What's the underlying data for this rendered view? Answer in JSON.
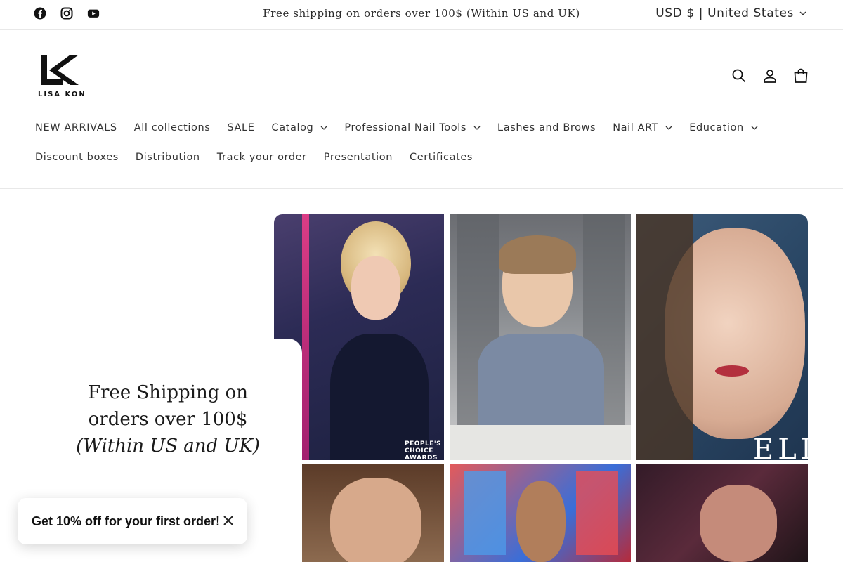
{
  "announcement": {
    "text": "Free shipping on orders over 100$ (Within US and UK)",
    "social_icons": [
      "facebook-icon",
      "instagram-icon",
      "youtube-icon"
    ],
    "currency_label": "USD $ | United States"
  },
  "brand": {
    "logo_text": "LISA KON"
  },
  "header": {
    "icons": [
      "search-icon",
      "account-icon",
      "cart-icon"
    ]
  },
  "nav": {
    "row1": [
      {
        "label": "NEW ARRIVALS",
        "dropdown": false
      },
      {
        "label": "All collections",
        "dropdown": false
      },
      {
        "label": "SALE",
        "dropdown": false
      },
      {
        "label": "Catalog",
        "dropdown": true
      },
      {
        "label": "Professional Nail Tools",
        "dropdown": true
      },
      {
        "label": "Lashes and Brows",
        "dropdown": false
      },
      {
        "label": "Nail ART",
        "dropdown": true
      },
      {
        "label": "Education",
        "dropdown": true
      }
    ],
    "row2": [
      {
        "label": "Discount boxes",
        "dropdown": false
      },
      {
        "label": "Distribution",
        "dropdown": false
      },
      {
        "label": "Track your order",
        "dropdown": false
      },
      {
        "label": "Presentation",
        "dropdown": false
      },
      {
        "label": "Certificates",
        "dropdown": false
      }
    ]
  },
  "hero": {
    "title_line": "Free Shipping on orders over 100$",
    "title_italic": "(Within US and UK)",
    "captions": {
      "peoples_choice": "PEOPLE'S\nCHOICE\nAWARDS",
      "elle": "ELL"
    }
  },
  "popup": {
    "text": "Get 10% off for your first order!"
  },
  "colors": {
    "text": "#121212",
    "border": "#e8e8e8",
    "accent_pink": "#e0507a"
  }
}
